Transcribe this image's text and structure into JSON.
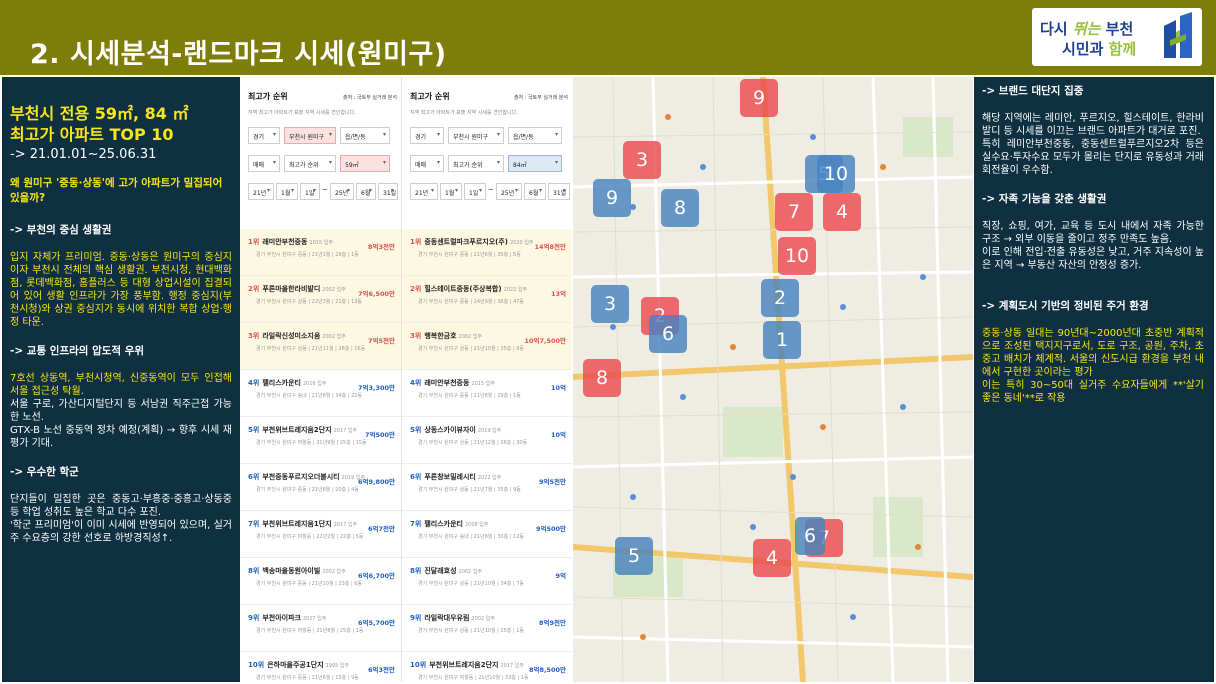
{
  "header": {
    "title": "2. 시세분석-랜드마크 시세(원미구)"
  },
  "logo": {
    "line1_a": "다시 ",
    "line1_accent": "뛰는",
    "line1_b": " 부천",
    "line2_a": "시민과 ",
    "line2_accent": "함께"
  },
  "left": {
    "heading1": "부천시 전용 59㎡, 84 ㎡",
    "heading2": "최고가 아파트 TOP 10",
    "period": "-> 21.01.01~25.06.31",
    "question": "왜 원미구 '중동·상동'에 고가 아파트가 밀집되어 있을까?",
    "s1_title": "-> 부천의 중심 생활권",
    "s1_text": "입지 자체가 프리미엄. 중동·상동은 원미구의 중심지이자 부천시 전체의 핵심 생활권. 부천시청, 현대백화점, 롯데백화점, 홈플러스 등 대형 상업시설이 집결되어 있어 생활 인프라가 가장 풍부함. 행정 중심지(부천시청)와 상권 중심지가 동시에 위치한 복합 상업·행정 타운.",
    "s2_title": "-> 교통 인프라의 압도적 우위",
    "s2_text_y": "7호선 상동역, 부천시청역, 신중동역이 모두 인접해 서울 접근성 탁월.",
    "s2_text_w1": "서울 구로, 가산디지털단지 등 서남권 직주근접 가능한 노선.",
    "s2_text_w2": "GTX-B 노선 중동역 정차 예정(계획) → 향후 시세 재평가 기대.",
    "s3_title": "-> 우수한 학군",
    "s3_text1": "단지들이 밀집한 곳은 중동고·부흥중·중흥고·상동중 등 학업 성취도 높은 학교 다수 포진.",
    "s3_text2": "'학군 프리미엄'이 이미 시세에 반영되어 있으며, 실거주 수요층의 강한 선호로 하방경직성↑."
  },
  "panel_common": {
    "title": "최고가 순위",
    "source": "출처 : 국토부 실거래 분석",
    "desc": "지역 최고가 아파트가 표출 지역 시세를 견인합니다.",
    "region": "경기",
    "city": "부천시 원미구",
    "dong": "읍/면/동",
    "trade": "매매",
    "sort": "최고가 순위",
    "date_from_y": "21년",
    "date_from_m": "1월",
    "date_from_d": "1일",
    "tilde": "~",
    "date_to_y": "25년",
    "date_to_m": "6월",
    "date_to_d": "31일"
  },
  "panel59": {
    "area": "59㎡",
    "rows": [
      {
        "rank": "1위",
        "name": "래미안부천중동",
        "year": "2015 입주",
        "meta": "경기 부천시 원미구 중동 | 21년1월 | 29층 | 1동",
        "price": "8억3천만"
      },
      {
        "rank": "2위",
        "name": "푸른마을한라비발디",
        "year": "2002 입주",
        "meta": "경기 부천시 원미구 상동 | 22년3월 | 21층 | 13동",
        "price": "7억6,500만"
      },
      {
        "rank": "3위",
        "name": "라일락신성미소지움",
        "year": "2002 입주",
        "meta": "경기 부천시 원미구 상동 | 21년11월 | 26층 | 16동",
        "price": "7억5천만"
      },
      {
        "rank": "4위",
        "name": "팰리스카운티",
        "year": "2016 입주",
        "meta": "경기 부천시 원미구 송내 | 21년8월 | 34층 | 22동",
        "price": "7억3,300만"
      },
      {
        "rank": "5위",
        "name": "부천위브트레지움2단지",
        "year": "2017 입주",
        "meta": "경기 부천시 원미구 여월동 | 21년9월 | 25층 | 15동",
        "price": "7억500만"
      },
      {
        "rank": "6위",
        "name": "부천중동푸르지오더블시티",
        "year": "2019 입주",
        "meta": "경기 부천시 원미구 중동 | 21년8월 | 20층 | 4동",
        "price": "6억9,800만"
      },
      {
        "rank": "7위",
        "name": "부천위브트레지움1단지",
        "year": "2017 입주",
        "meta": "경기 부천시 원미구 여월동 | 22년2월 | 22층 | 5동",
        "price": "6억7천만"
      },
      {
        "rank": "8위",
        "name": "백송마을동원아이빌",
        "year": "2002 입주",
        "meta": "경기 부천시 원미구 중동 | 21년10월 | 23층 | 6동",
        "price": "6억6,700만"
      },
      {
        "rank": "9위",
        "name": "부천아이파크",
        "year": "2017 입주",
        "meta": "경기 부천시 원미구 여월동 | 21년8월 | 25층 | 1동",
        "price": "6억5,700만"
      },
      {
        "rank": "10위",
        "name": "은하마을주공1단지",
        "year": "1995 입주",
        "meta": "경기 부천시 원미구 중동 | 21년6월 | 15층 | 9동",
        "price": "6억3천만"
      }
    ]
  },
  "panel84": {
    "area": "84㎡",
    "rows": [
      {
        "rank": "1위",
        "name": "중동센트럴파크푸르지오(주)",
        "year": "2020 입주",
        "meta": "경기 부천시 원미구 중동 | 21년6월 | 35층 | 5동",
        "price": "14억8천만"
      },
      {
        "rank": "2위",
        "name": "힐스테이트중동(주상복합)",
        "year": "2022 입주",
        "meta": "경기 부천시 원미구 중동 | 24년9월 | 36층 | 47동",
        "price": "13억"
      },
      {
        "rank": "3위",
        "name": "행복한금호",
        "year": "2002 입주",
        "meta": "경기 부천시 원미구 상동 | 21년10월 | 35층 | 8동",
        "price": "10억7,500만"
      },
      {
        "rank": "4위",
        "name": "래미안부천중동",
        "year": "2015 입주",
        "meta": "경기 부천시 원미구 중동 | 21년8월 | 29층 | 1동",
        "price": "10억"
      },
      {
        "rank": "5위",
        "name": "상동스카이뷰자이",
        "year": "2019 입주",
        "meta": "경기 부천시 원미구 상동 | 21년12월 | 36층 | 30동",
        "price": "10억"
      },
      {
        "rank": "6위",
        "name": "푸른창보밀레시티",
        "year": "2022 입주",
        "meta": "경기 부천시 원미구 상동 | 21년7월 | 35층 | 9동",
        "price": "9억5천만"
      },
      {
        "rank": "7위",
        "name": "팰리스카운티",
        "year": "2008 입주",
        "meta": "경기 부천시 원미구 송내 | 21년8월 | 30층 | 12동",
        "price": "9억500만"
      },
      {
        "rank": "8위",
        "name": "진달래효성",
        "year": "2002 입주",
        "meta": "경기 부천시 원미구 상동 | 21년10월 | 34층 | 7동",
        "price": "9억"
      },
      {
        "rank": "9위",
        "name": "라일락대우유림",
        "year": "2002 입주",
        "meta": "경기 부천시 원미구 상동 | 21년10월 | 25층 | 1동",
        "price": "8억9천만"
      },
      {
        "rank": "10위",
        "name": "부천위브트레지움2단지",
        "year": "2017 입주",
        "meta": "경기 부천시 원미구 여월동 | 21년10월 | 33층 | 1동",
        "price": "8억8,500만"
      }
    ]
  },
  "map": {
    "red_markers": [
      "9",
      "3",
      "7",
      "4",
      "10",
      "2",
      "8",
      "4",
      "7"
    ],
    "blue_markers": [
      "9",
      "8",
      "10",
      "5",
      "3",
      "2",
      "6",
      "1",
      "5",
      "6"
    ]
  },
  "right": {
    "s1_title": "-> 브랜드 대단지 집중",
    "s1_text": "해당 지역에는 레미안, 푸르지오, 힐스테이트, 한라비발디 등 시세를 이끄는 브랜드 아파트가 대거로 포진.",
    "s1_text2": "특히 레미안부천중동, 중동센트럴푸르지오2차 등은 실수요·투자수요 모두가 몰리는 단지로 유동성과 거래 회전율이 우수함.",
    "s2_title": "-> 자족 기능을 갖춘 생활권",
    "s2_text1": "직장, 쇼핑, 여가, 교육 등 도시 내에서 자족 가능한 구조 → 외부 이동을 줄이고 정주 만족도 높음.",
    "s2_text2": "이로 인해 전입·전출 유동성은 낮고, 거주 지속성이 높은 지역 → 부동산 자산의 안정성 증가.",
    "s3_title": "-> 계획도시 기반의 정비된 주거 환경",
    "s3_text1": "중동·상동 일대는 90년대~2000년대 초중반 계획적으로 조성된 택지지구로서, 도로 구조, 공원, 주차, 초중고 배치가 체계적. 서울의 신도시급 환경을 부천 내에서 구현한 곳이라는 평가",
    "s3_text2": "이는 특히 30~50대 실거주 수요자들에게 **'살기 좋은 동네'**로 작용"
  }
}
